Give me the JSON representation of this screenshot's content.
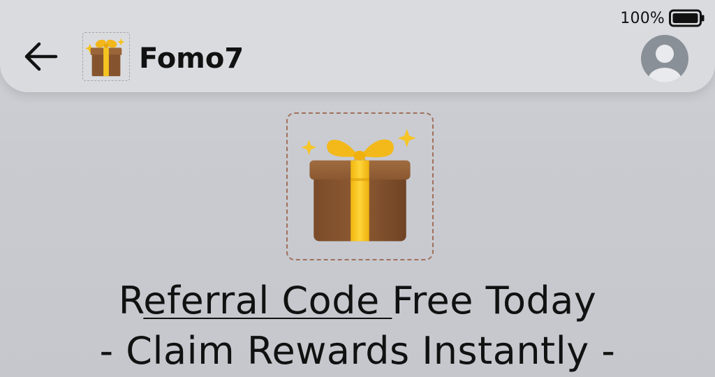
{
  "status_bar": {
    "battery_percent": "100%",
    "battery_level": 1.0
  },
  "header": {
    "title": "Fomo7",
    "back_icon": "arrow-left-icon",
    "app_icon": "gift-icon",
    "avatar_icon": "user-avatar-icon"
  },
  "main": {
    "hero_icon": "gift-sparkles-icon",
    "headline": {
      "prefix": "R",
      "link_text": "eferral Code ",
      "suffix": "Free Today",
      "line2": "- Claim Rewards Instantly -"
    }
  },
  "colors": {
    "gift_box": "#8b5a34",
    "ribbon": "#f5c31f",
    "dashed_frame": "#a0705a"
  }
}
